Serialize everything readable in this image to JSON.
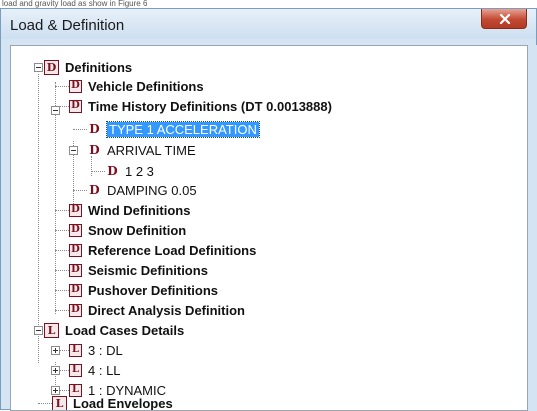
{
  "top_fragment": "load and gravity load as show in Figure 6",
  "window": {
    "title": "Load & Definition",
    "close_symbol": "×"
  },
  "tree": {
    "definitions": {
      "icon": "D",
      "label": "Definitions"
    },
    "vehicle": {
      "icon": "D",
      "label": "Vehicle Definitions"
    },
    "time_history": {
      "icon": "D",
      "label": "Time History Definitions (DT 0.0013888)"
    },
    "type1_accel": {
      "icon": "D",
      "label": "TYPE 1 ACCELERATION"
    },
    "arrival_time": {
      "icon": "D",
      "label": "ARRIVAL TIME"
    },
    "arrival_123": {
      "icon": "D",
      "label": "1 2 3"
    },
    "damping": {
      "icon": "D",
      "label": "DAMPING 0.05"
    },
    "wind": {
      "icon": "D",
      "label": "Wind Definitions"
    },
    "snow": {
      "icon": "D",
      "label": "Snow Definition"
    },
    "reference": {
      "icon": "D",
      "label": "Reference Load Definitions"
    },
    "seismic": {
      "icon": "D",
      "label": "Seismic Definitions"
    },
    "pushover": {
      "icon": "D",
      "label": "Pushover Definitions"
    },
    "direct": {
      "icon": "D",
      "label": "Direct Analysis Definition"
    },
    "load_cases": {
      "icon": "L",
      "label": "Load Cases Details"
    },
    "case_dl": {
      "icon": "L",
      "label": "3 : DL"
    },
    "case_ll": {
      "icon": "L",
      "label": "4 : LL"
    },
    "case_dynamic": {
      "icon": "L",
      "label": "1 : DYNAMIC"
    },
    "envelopes": {
      "icon": "L",
      "label": "Load Envelopes"
    }
  },
  "colors": {
    "icon_red": "#7d0f1e",
    "selection": "#3399ff",
    "window_frame": "#d5e4f2"
  }
}
